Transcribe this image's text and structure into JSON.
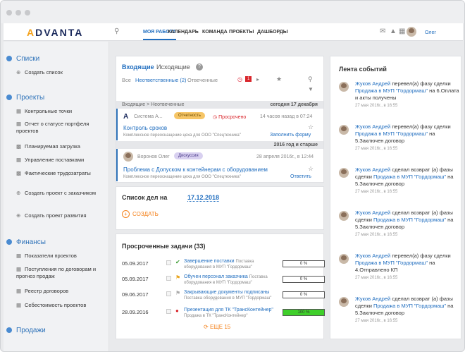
{
  "topnav": {
    "logo_a": "A",
    "logo_rest": "DVANTA",
    "links": [
      "МОЯ РАБОТА",
      "КАЛЕНДАРЬ",
      "КОМАНДА",
      "ПРОЕКТЫ",
      "ДАШБОРДЫ"
    ],
    "user": "Олег"
  },
  "sidebar": {
    "lists_title": "Списки",
    "create_list": "Создать список",
    "projects_title": "Проекты",
    "projects_items": [
      "Контрольные точки",
      "Отчет о статусе портфеля проектов",
      "Планируемая загрузка",
      "Управление поставками",
      "Фактические трудозатраты"
    ],
    "create_customer": "Создать проект с заказчиком",
    "create_dev": "Создать проект развития",
    "finance_title": "Финансы",
    "finance_items": [
      "Показатели проектов",
      "Поступления по договорам и прогноз продаж",
      "Реестр договоров",
      "Себестоимость проектов"
    ],
    "sales_title": "Продажи"
  },
  "inbox": {
    "tab_in": "Входящие",
    "tab_out": "Исходящие",
    "help": "?",
    "filter_all": "Все",
    "filter_unanswered": "Неответственные (2)",
    "filter_answered": "Отвеченные",
    "count": "1",
    "breadcrumb": "Входящие > Неотвеченные",
    "group1": "сегодня 17 декабря",
    "m1_from": "Система А...",
    "m1_status": "Отчетность",
    "m1_overdue": "Просрочено",
    "m1_time": "14 часов назад в 07:24",
    "m1_title": "Контроль сроков",
    "m1_sub": "Комплексное переоснащение цеха для ООО \"Спецтехника\"",
    "m1_action": "Заполнить форму",
    "group2": "2016 год и старше",
    "m2_from": "Воронов Олег",
    "m2_status": "Дискуссия",
    "m2_time": "28 апреля 2016г., в 12:44",
    "m2_title": "Проблема с Допуском к контейнерам с оборудованием",
    "m2_sub": "Комплексное переоснащение цеха для ООО \"Спецтехника\"",
    "m2_action": "Ответить"
  },
  "todo": {
    "title": "Список дел на",
    "date": "17.12.2018",
    "create": "СОЗДАТЬ"
  },
  "overdue": {
    "title": "Просроченные задачи (33)",
    "more": "ЕЩЕ 15",
    "rows": [
      {
        "date": "05.09.2017",
        "task": "Завершение поставки",
        "sub": "Поставка оборудования в МУП \"Гордормаш\"",
        "pct": "0 %",
        "fill": 0
      },
      {
        "date": "05.09.2017",
        "task": "Обучен персонал заказчика",
        "sub": "Поставка оборудования в МУП \"Гордормаш\"",
        "pct": "0 %",
        "fill": 0
      },
      {
        "date": "09.06.2017",
        "task": "Закрывающие документы подписаны",
        "sub": "Поставка оборудования в МУП \"Гордормаш\"",
        "pct": "0 %",
        "fill": 0
      },
      {
        "date": "28.09.2016",
        "task": "Презентация для ТК \"ТрансКонтейнер\"",
        "sub": "Продажа в ТК \"ТрансКонтейнер\"",
        "pct": "100 %",
        "fill": 100
      }
    ]
  },
  "feed": {
    "title": "Лента событий",
    "items": [
      {
        "who": "Жуков Андрей",
        "act": " перевел(а) фазу сделки ",
        "deal": "Продажа в МУП \"Гордормаш\"",
        "tail": " на 6.Оплата и акты получены",
        "date": "27 мая 2016г., в 16:55"
      },
      {
        "who": "Жуков Андрей",
        "act": " перевел(а) фазу сделки ",
        "deal": "Продажа в МУП \"Гордормаш\"",
        "tail": " на 5.Заключен договор",
        "date": "27 мая 2016г., в 16:55"
      },
      {
        "who": "Жуков Андрей",
        "act": " сделал возврат (а) фазы сделки ",
        "deal": "Продажа в МУП \"Гордормаш\"",
        "tail": " на 5.Заключен договор",
        "date": "27 мая 2016г., в 16:55"
      },
      {
        "who": "Жуков Андрей",
        "act": " сделал возврат (а) фазы сделки ",
        "deal": "Продажа в МУП \"Гордормаш\"",
        "tail": " на 5.Заключен договор",
        "date": "27 мая 2016г., в 16:55"
      },
      {
        "who": "Жуков Андрей",
        "act": " перевел(а) фазу сделки ",
        "deal": "Продажа в МУП \"Гордормаш\"",
        "tail": " на 4.Отправлено КП",
        "date": "27 мая 2016г., в 16:55"
      },
      {
        "who": "Жуков Андрей",
        "act": " сделал возврат (а) фазы сделки ",
        "deal": "Продажа в МУП \"Гордормаш\"",
        "tail": " на 5.Заключен договор",
        "date": "27 мая 2016г., в 16:55"
      }
    ]
  }
}
